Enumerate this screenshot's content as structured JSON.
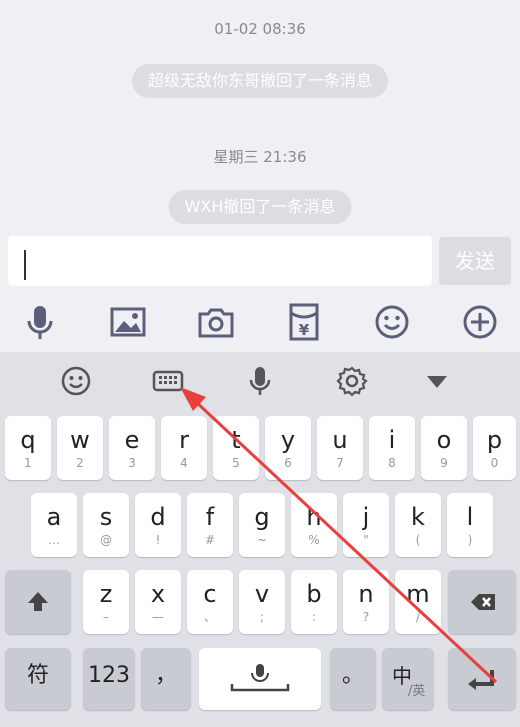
{
  "chat": {
    "timestamp1": "01-02 08:36",
    "notice1": "超级无敌你东哥撤回了一条消息",
    "timestamp2": "星期三 21:36",
    "notice2": "WXH撤回了一条消息"
  },
  "input": {
    "value": "",
    "send_label": "发送"
  },
  "toolbar": {
    "icons": [
      "microphone-icon",
      "image-icon",
      "camera-icon",
      "red-packet-icon",
      "emoji-icon",
      "plus-icon"
    ],
    "red_packet_symbol": "¥"
  },
  "keyboard": {
    "top_icons": [
      "emoji-icon",
      "keyboard-icon",
      "microphone-icon",
      "settings-icon",
      "collapse-icon"
    ],
    "row1": [
      {
        "main": "q",
        "sub": "1"
      },
      {
        "main": "w",
        "sub": "2"
      },
      {
        "main": "e",
        "sub": "3"
      },
      {
        "main": "r",
        "sub": "4"
      },
      {
        "main": "t",
        "sub": "5"
      },
      {
        "main": "y",
        "sub": "6"
      },
      {
        "main": "u",
        "sub": "7"
      },
      {
        "main": "i",
        "sub": "8"
      },
      {
        "main": "o",
        "sub": "9"
      },
      {
        "main": "p",
        "sub": "0"
      }
    ],
    "row2": [
      {
        "main": "a",
        "sub": "…"
      },
      {
        "main": "s",
        "sub": "@"
      },
      {
        "main": "d",
        "sub": "!"
      },
      {
        "main": "f",
        "sub": "#"
      },
      {
        "main": "g",
        "sub": "~"
      },
      {
        "main": "h",
        "sub": "%"
      },
      {
        "main": "j",
        "sub": "\""
      },
      {
        "main": "k",
        "sub": "("
      },
      {
        "main": "l",
        "sub": ")"
      }
    ],
    "row3": [
      {
        "main": "z",
        "sub": "–"
      },
      {
        "main": "x",
        "sub": "—"
      },
      {
        "main": "c",
        "sub": "、"
      },
      {
        "main": "v",
        "sub": ";"
      },
      {
        "main": "b",
        "sub": ":"
      },
      {
        "main": "n",
        "sub": "?"
      },
      {
        "main": "m",
        "sub": "/"
      }
    ],
    "symbols_label": "符",
    "numbers_label": "123",
    "comma_label": "，",
    "period_label": "。",
    "lang_main": "中",
    "lang_sub": "/英"
  },
  "colors": {
    "annotation_arrow": "#e8403a"
  }
}
